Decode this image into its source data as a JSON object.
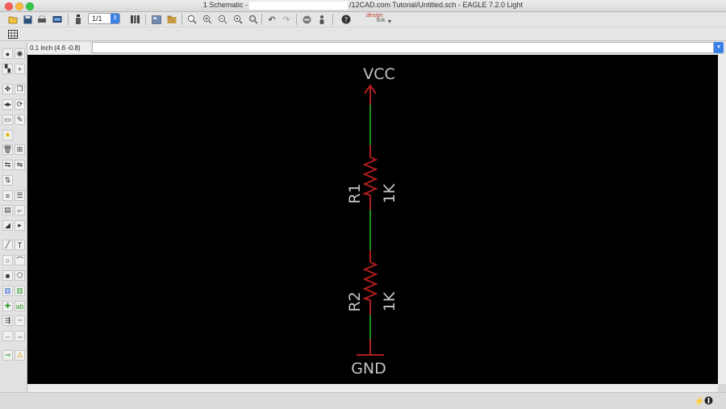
{
  "window": {
    "title_prefix": "1 Schematic -",
    "title_suffix": "/12CAD.com Tutorial/Untitled.sch - EAGLE 7.2.0 Light"
  },
  "toolbar": {
    "sheet_value": "1/1",
    "designlink_top": "design",
    "designlink_bottom": "link"
  },
  "command": {
    "coordinates": "0.1 inch (4.6 -0.8)",
    "command_value": ""
  },
  "schematic": {
    "supply_top": "VCC",
    "supply_bottom": "GND",
    "parts": [
      {
        "name": "R1",
        "value": "1K"
      },
      {
        "name": "R2",
        "value": "1K"
      }
    ]
  },
  "colors": {
    "canvas": "#000000",
    "symbol": "#b01e1e",
    "net": "#1e8f1e",
    "label": "#c4c4c4"
  }
}
